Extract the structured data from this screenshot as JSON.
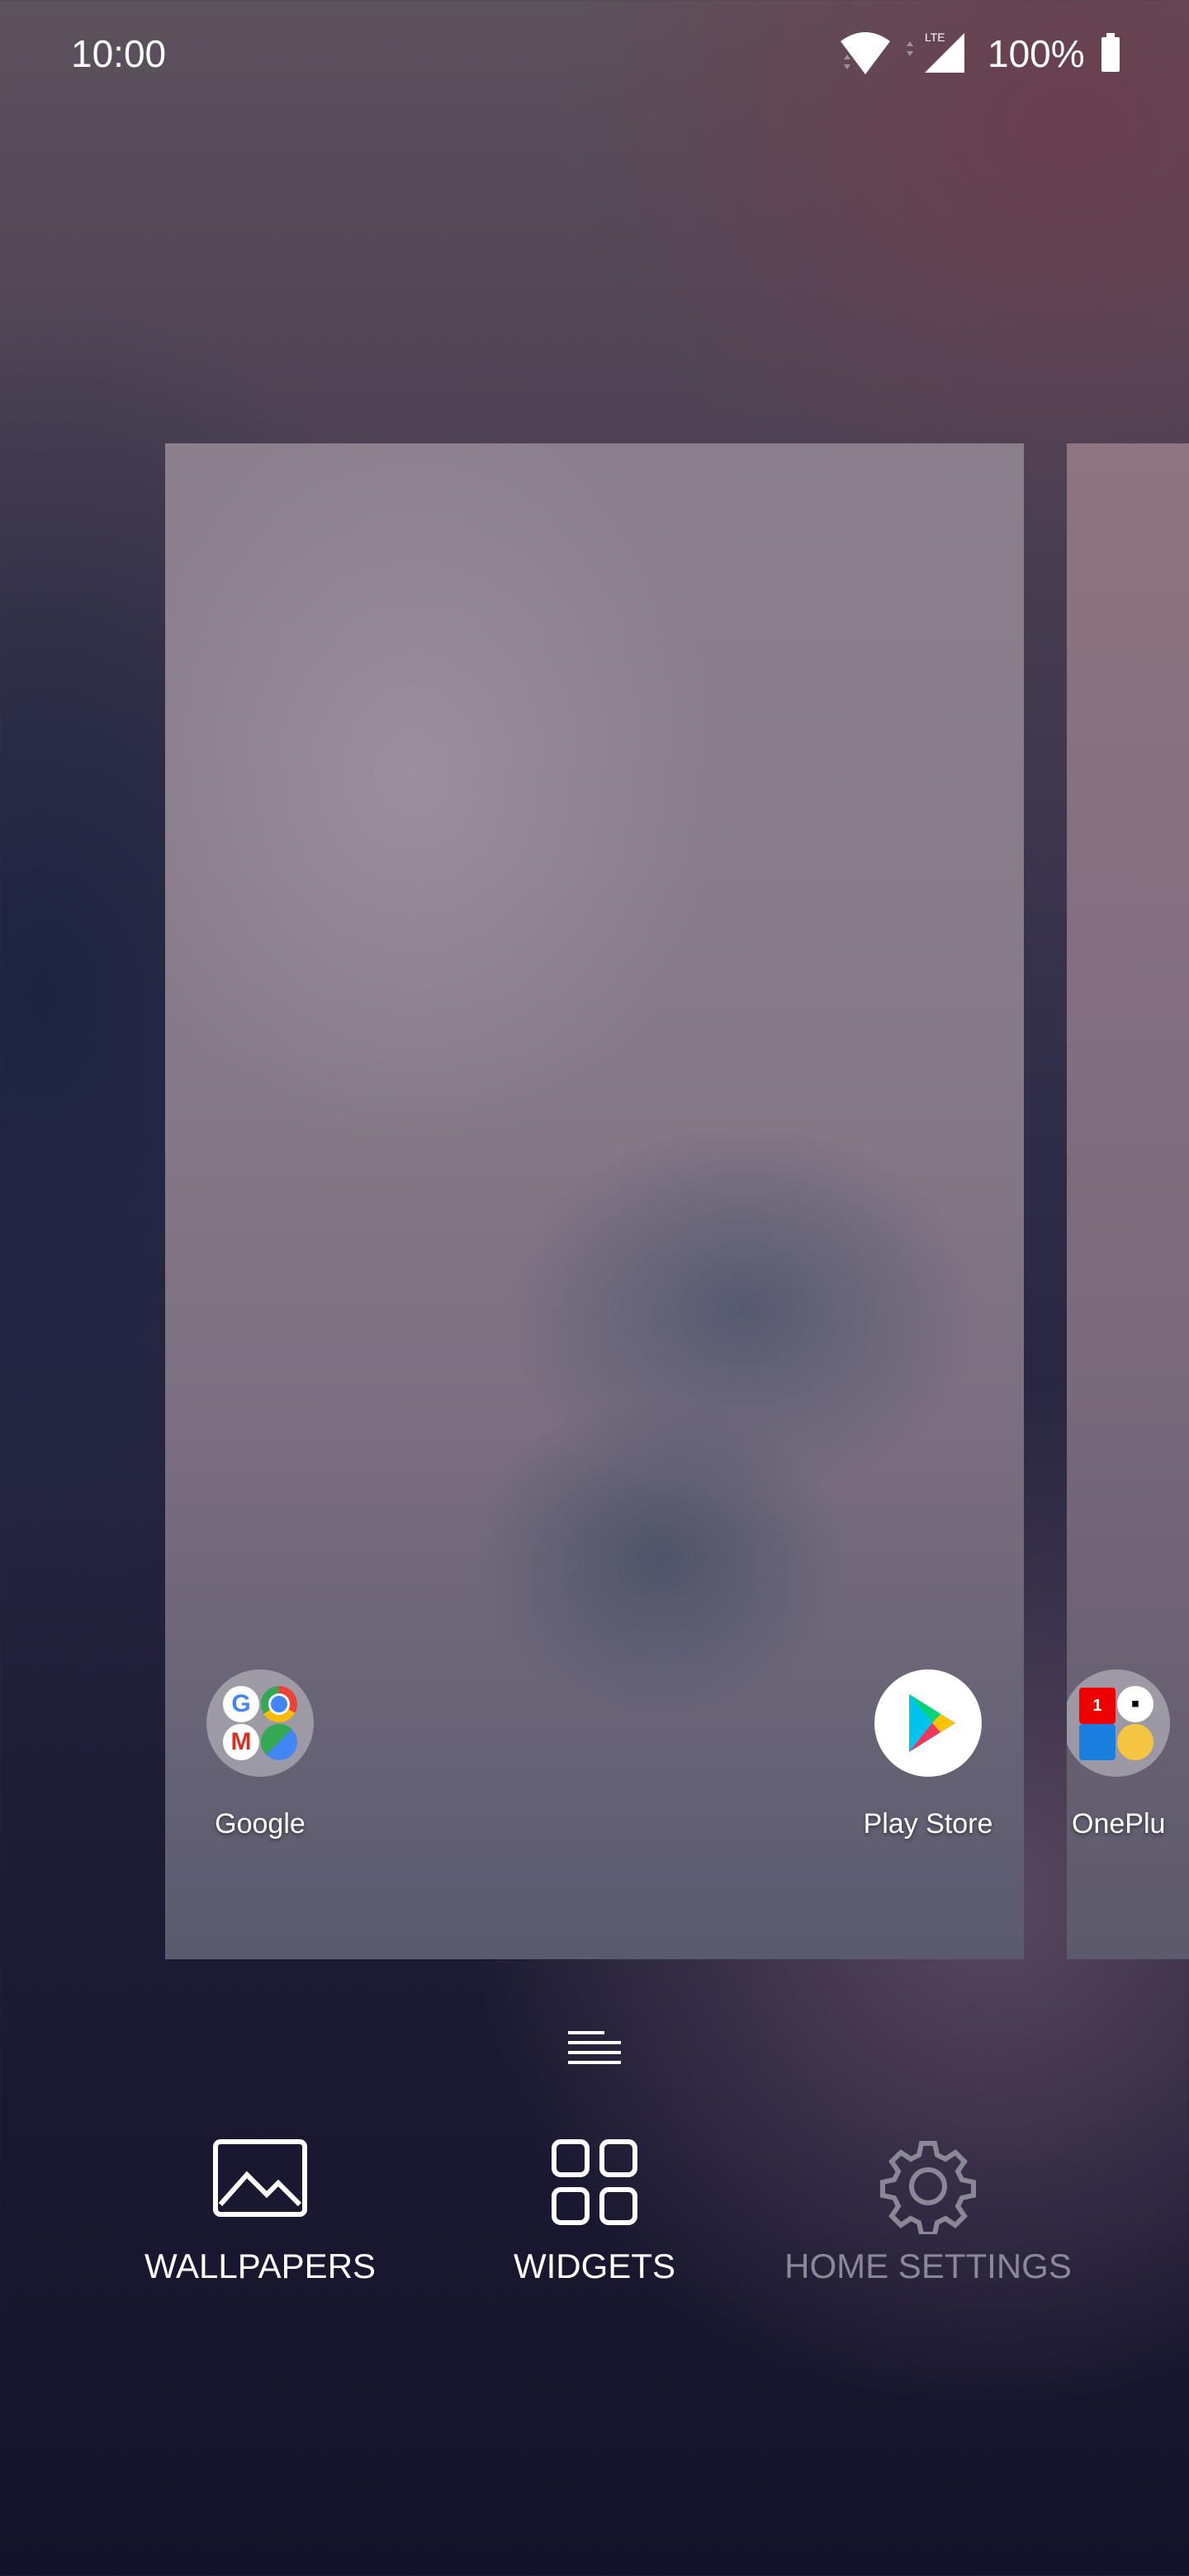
{
  "status_bar": {
    "time": "10:00",
    "network": "LTE",
    "battery": "100%",
    "icons": [
      "wifi-icon",
      "signal-icon",
      "battery-icon"
    ]
  },
  "home_preview": {
    "apps": [
      {
        "label": "Google",
        "icon": "google-folder-icon"
      },
      {
        "label": "Play Store",
        "icon": "play-store-icon"
      },
      {
        "label": "OnePlu",
        "icon": "oneplus-folder-icon"
      }
    ]
  },
  "menu_icon": "menu-lines-icon",
  "options": [
    {
      "label": "WALLPAPERS",
      "icon": "image-icon"
    },
    {
      "label": "WIDGETS",
      "icon": "grid-icon"
    },
    {
      "label": "HOME SETTINGS",
      "icon": "gear-icon"
    }
  ],
  "colors": {
    "disabled_text": "#8a8796",
    "text": "#ffffff"
  }
}
